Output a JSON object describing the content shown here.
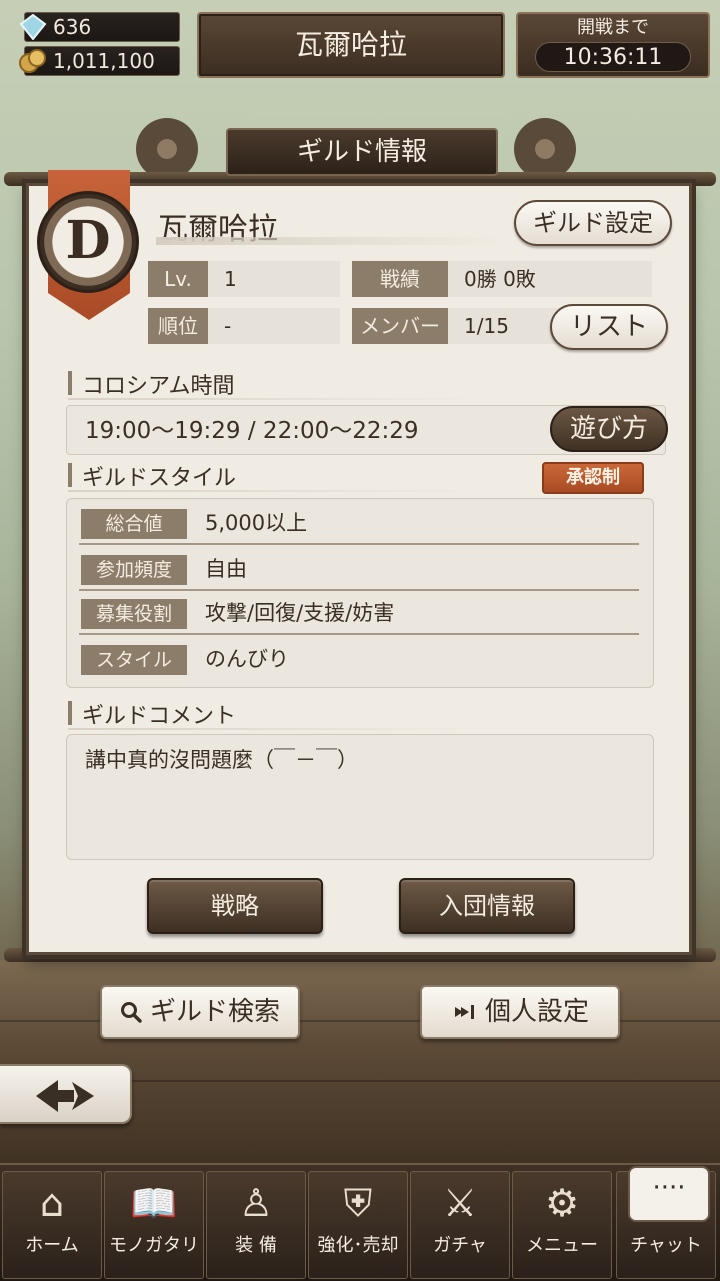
{
  "status": {
    "gems": "636",
    "coins": "1,011,100",
    "gem_icon": "crystal-icon",
    "coin_icon": "coins-icon"
  },
  "header": {
    "guild_title": "瓦爾哈拉",
    "timer_label": "開戦まで",
    "timer_value": "10:36:11"
  },
  "panel": {
    "title": "ギルド情報",
    "emblem_letter": "D",
    "guild_name": "瓦爾哈拉",
    "settings_button": "ギルド設定",
    "stats": {
      "level_label": "Lv.",
      "level_value": "1",
      "record_label": "戦績",
      "record_value": "0勝 0敗",
      "rank_label": "順位",
      "rank_value": "-",
      "member_label": "メンバー",
      "member_value": "1/15",
      "list_button": "リスト"
    },
    "colosseum": {
      "title": "コロシアム時間",
      "time": "19:00〜19:29  /  22:00〜22:29",
      "howto_button": "遊び方"
    },
    "guild_style": {
      "title": "ギルドスタイル",
      "approval_badge": "承認制",
      "rows": [
        {
          "label": "総合値",
          "value": "5,000以上"
        },
        {
          "label": "参加頻度",
          "value": "自由"
        },
        {
          "label": "募集役割",
          "value": "攻撃/回復/支援/妨害"
        },
        {
          "label": "スタイル",
          "value": "のんびり"
        }
      ]
    },
    "comment": {
      "title": "ギルドコメント",
      "text": "講中真的沒問題麼（￣－￣）"
    },
    "strategy_button": "戦略",
    "join_info_button": "入団情報"
  },
  "actions": {
    "guild_search": "ギルド検索",
    "personal_settings": "個人設定",
    "back_icon": "back-arrow-icon"
  },
  "nav": [
    {
      "label": "ホーム",
      "icon": "castle-icon",
      "glyph": "⌂"
    },
    {
      "label": "モノガタリ",
      "icon": "book-icon",
      "glyph": "📖"
    },
    {
      "label": "装 備",
      "icon": "equipment-icon",
      "glyph": "♙"
    },
    {
      "label": "強化･売却",
      "icon": "armor-icon",
      "glyph": "⛨"
    },
    {
      "label": "ガチャ",
      "icon": "crossed-swords-icon",
      "glyph": "⚔"
    },
    {
      "label": "メニュー",
      "icon": "gears-icon",
      "glyph": "⚙"
    },
    {
      "label": "チャット",
      "icon": "chat-icon",
      "glyph": "…"
    }
  ],
  "chat_bubble": "····"
}
